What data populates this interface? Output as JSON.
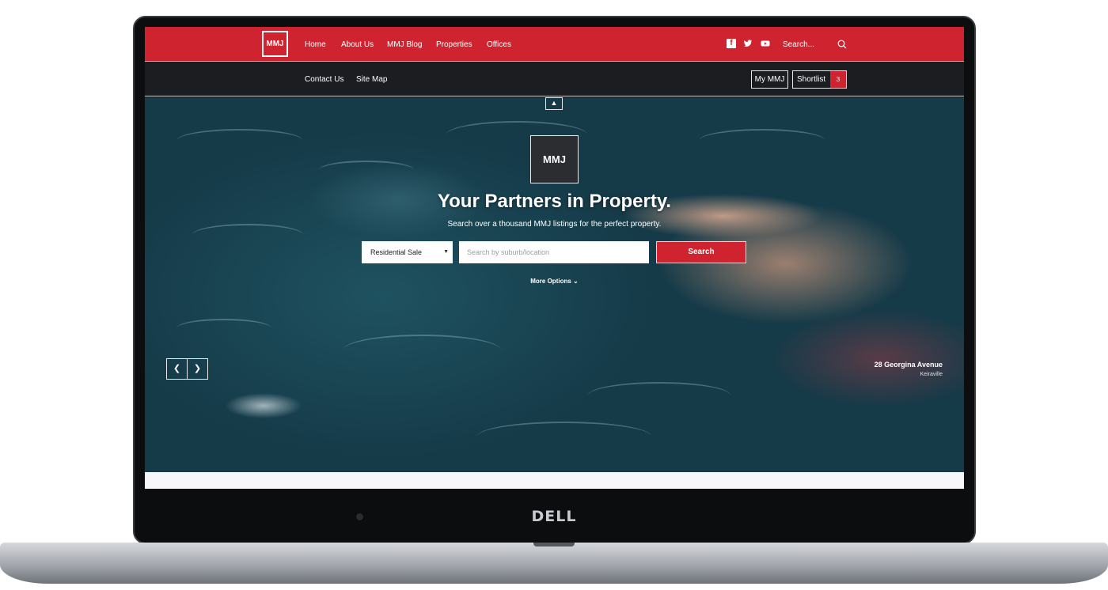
{
  "device": {
    "brand": "DELL"
  },
  "site": {
    "logo_text": "MMJ"
  },
  "nav": {
    "items": [
      "Home",
      "About Us",
      "MMJ Blog",
      "Properties",
      "Offices"
    ],
    "search_placeholder": "Search..."
  },
  "subnav": {
    "items": [
      "Contact Us",
      "Site Map"
    ],
    "my_account": "My MMJ",
    "shortlist": "Shortlist",
    "shortlist_count": "3"
  },
  "hero": {
    "title": "Your Partners in Property.",
    "subtitle": "Search over a thousand MMJ listings for the perfect property.",
    "listing_type": "Residential Sale",
    "location_placeholder": "Search by suburb/location",
    "search_button": "Search",
    "more_options": "More Options",
    "caption_street": "28 Georgina Avenue",
    "caption_suburb": "Keiraville"
  },
  "colors": {
    "brand_red": "#cf242f",
    "dark_nav": "#1c1e22"
  },
  "icons": [
    "facebook-icon",
    "twitter-icon",
    "youtube-icon",
    "search-icon",
    "chevron-up-icon",
    "chevron-down-icon",
    "chevron-left-icon",
    "chevron-right-icon"
  ]
}
